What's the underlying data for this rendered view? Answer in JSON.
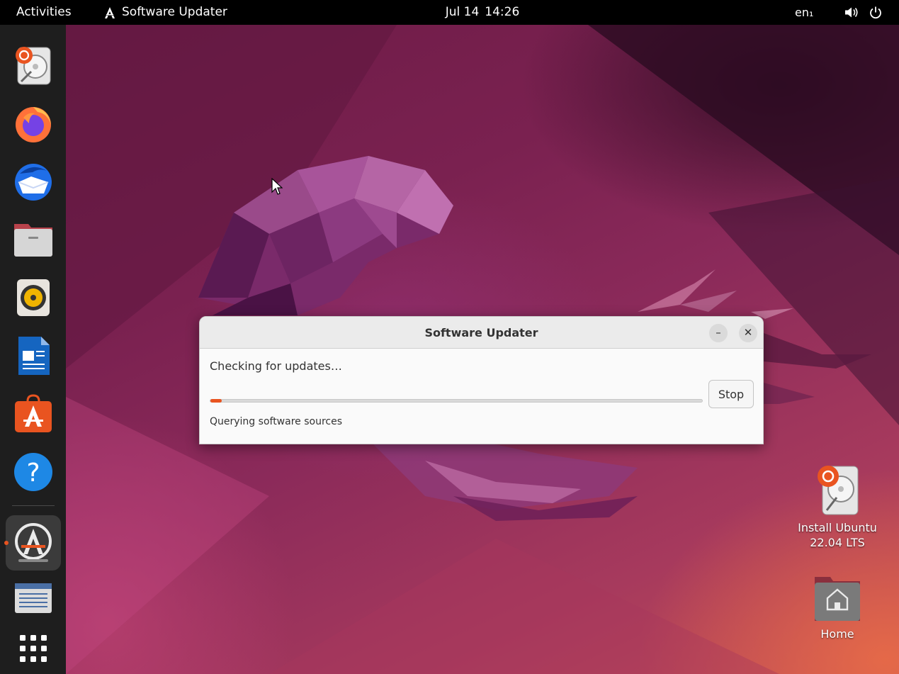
{
  "topbar": {
    "activities": "Activities",
    "app_name": "Software Updater",
    "date": "Jul 14",
    "time": "14:26",
    "language": "en₁",
    "volume_icon": "speaker-icon",
    "power_icon": "power-icon"
  },
  "dock": {
    "items": [
      {
        "name": "install-ubuntu",
        "icon": "install-ubuntu-icon"
      },
      {
        "name": "firefox",
        "icon": "firefox-icon"
      },
      {
        "name": "thunderbird",
        "icon": "thunderbird-icon"
      },
      {
        "name": "files",
        "icon": "files-icon"
      },
      {
        "name": "rhythmbox",
        "icon": "rhythmbox-icon"
      },
      {
        "name": "libreoffice-writer",
        "icon": "writer-icon"
      },
      {
        "name": "ubuntu-software",
        "icon": "software-store-icon"
      },
      {
        "name": "help",
        "icon": "help-icon"
      },
      {
        "name": "software-updater",
        "icon": "software-updater-icon",
        "active": true
      },
      {
        "name": "text-document",
        "icon": "document-icon"
      },
      {
        "name": "show-applications",
        "icon": "app-grid-icon"
      }
    ]
  },
  "dialog": {
    "title": "Software Updater",
    "heading": "Checking for updates…",
    "detail": "Querying software sources",
    "stop_label": "Stop",
    "progress": 0.02
  },
  "desktop_icons": [
    {
      "label_line1": "Install Ubuntu",
      "label_line2": "22.04 LTS"
    },
    {
      "label": "Home"
    }
  ],
  "colors": {
    "accent": "#e95420",
    "topbar": "#000000",
    "dock": "#1e1e1e"
  }
}
